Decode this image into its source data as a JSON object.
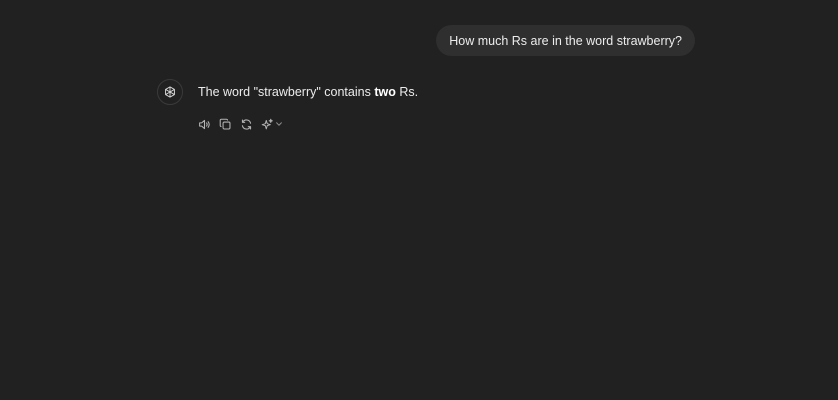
{
  "conversation": {
    "user_message": "How much Rs are in the word strawberry?",
    "assistant": {
      "text_before": "The word \"strawberry\" contains ",
      "text_bold": "two",
      "text_after": " Rs."
    }
  },
  "actions": [
    {
      "icon": "speaker-icon"
    },
    {
      "icon": "copy-icon"
    },
    {
      "icon": "regenerate-icon"
    },
    {
      "icon": "sparkle-icon"
    },
    {
      "icon": "chevron-down-icon"
    }
  ],
  "colors": {
    "background": "#212121",
    "user_bubble": "#2f2f2f",
    "text": "#ececec",
    "icon": "#b4b4b4"
  }
}
